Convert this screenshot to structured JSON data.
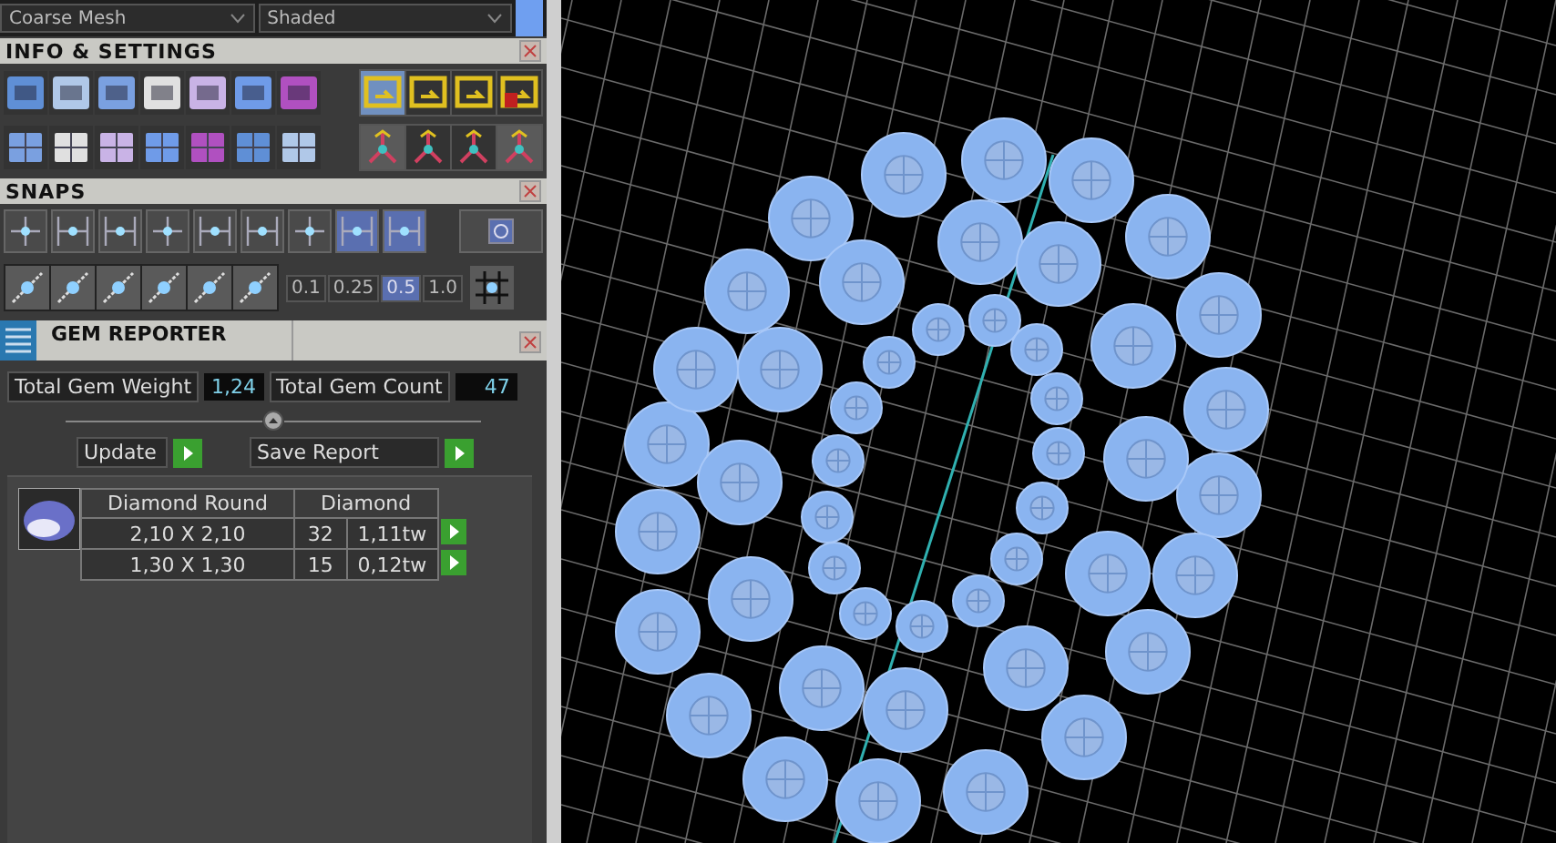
{
  "toolbar": {
    "mesh_dropdown": "Coarse Mesh",
    "shading_dropdown": "Shaded"
  },
  "info_settings": {
    "title": "INFO & SETTINGS"
  },
  "snaps": {
    "title": "SNAPS",
    "buttons": [
      {
        "selected": false
      },
      {
        "selected": false
      },
      {
        "selected": false
      },
      {
        "selected": false
      },
      {
        "selected": false
      },
      {
        "selected": false
      },
      {
        "selected": false
      },
      {
        "selected": true
      },
      {
        "selected": true
      }
    ],
    "grid_values": [
      {
        "label": "0.1",
        "selected": false
      },
      {
        "label": "0.25",
        "selected": false
      },
      {
        "label": "0.5",
        "selected": true
      },
      {
        "label": "1.0",
        "selected": false
      }
    ]
  },
  "gem_reporter": {
    "title": "GEM REPORTER",
    "total_weight_label": "Total Gem Weight",
    "total_weight": "1,24",
    "total_count_label": "Total Gem Count",
    "total_count": "47",
    "buttons": [
      "Update",
      "Save Report"
    ],
    "table": {
      "columns": [
        "Diamond Round",
        "Diamond"
      ],
      "rows": [
        {
          "size": "2,10 X 2,10",
          "count": "32",
          "weight": "1,11tw"
        },
        {
          "size": "1,30 X 1,30",
          "count": "15",
          "weight": "0,12tw"
        }
      ]
    }
  }
}
